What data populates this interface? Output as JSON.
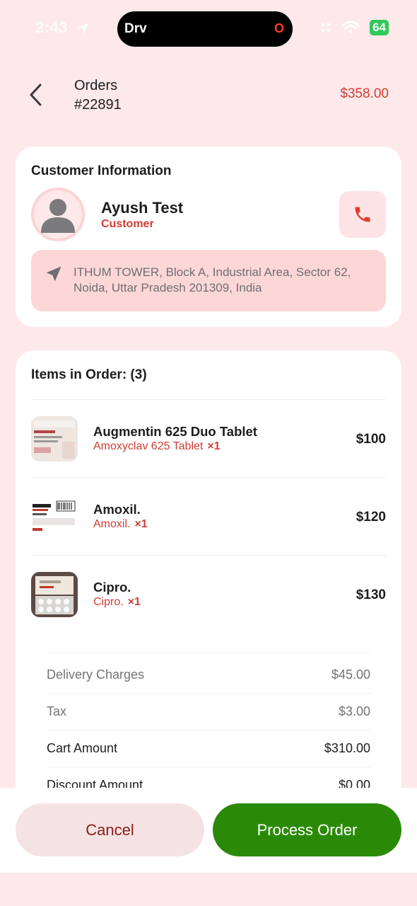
{
  "status_bar": {
    "time": "2:43",
    "island_label": "Drv",
    "island_indicator": "O",
    "battery": "64"
  },
  "header": {
    "title_line1": "Orders",
    "title_line2": "#22891",
    "total": "$358.00",
    "back_icon": "chevron-left-icon"
  },
  "customer": {
    "section_title": "Customer Information",
    "name": "Ayush Test",
    "role": "Customer",
    "address": "ITHUM TOWER, Block A, Industrial Area, Sector 62, Noida, Uttar Pradesh 201309, India"
  },
  "items": {
    "section_title": "Items in Order: (3)",
    "list": [
      {
        "name": "Augmentin 625 Duo Tablet",
        "sub": "Amoxyclav 625 Tablet",
        "qty": "×1",
        "price": "$100"
      },
      {
        "name": "Amoxil.",
        "sub": "Amoxil.",
        "qty": "×1",
        "price": "$120"
      },
      {
        "name": "Cipro.",
        "sub": "Cipro.",
        "qty": "×1",
        "price": "$130"
      }
    ]
  },
  "summary": [
    {
      "label": "Delivery Charges",
      "value": "$45.00"
    },
    {
      "label": "Tax",
      "value": "$3.00"
    },
    {
      "label": "Cart Amount",
      "value": "$310.00"
    },
    {
      "label": "Discount Amount",
      "value": "$0.00"
    }
  ],
  "actions": {
    "cancel_label": "Cancel",
    "process_label": "Process Order"
  },
  "colors": {
    "accent_red": "#d23c32",
    "process_green": "#2a8a08",
    "background": "#fde9ea"
  }
}
